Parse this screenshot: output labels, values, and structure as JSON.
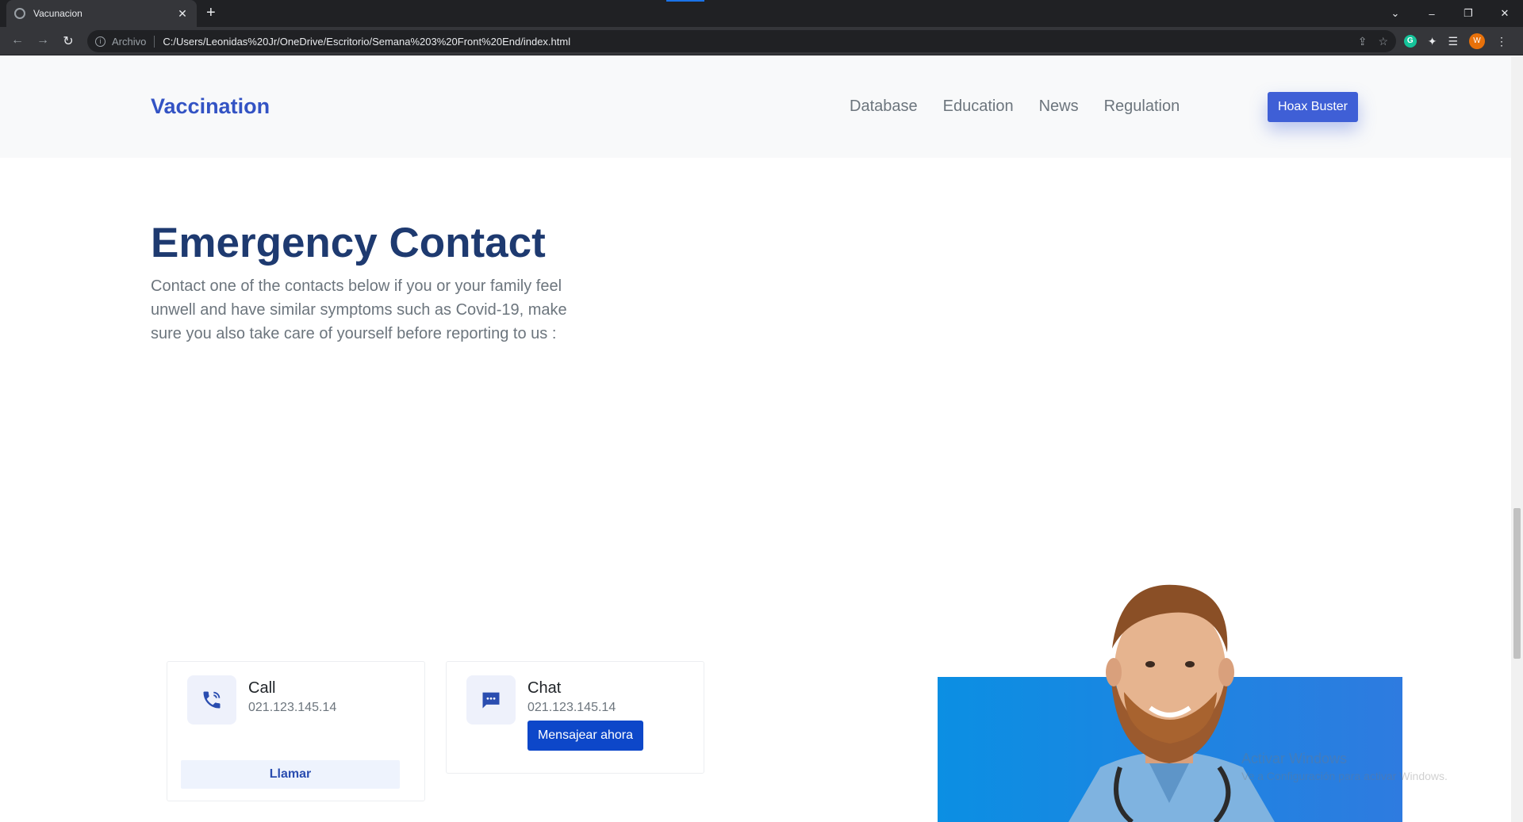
{
  "browser": {
    "tab_title": "Vacunacion",
    "new_tab": "+",
    "address_label": "Archivo",
    "url": "C:/Users/Leonidas%20Jr/OneDrive/Escritorio/Semana%203%20Front%20End/index.html",
    "profile_initial": "W",
    "window_controls": [
      "⌄",
      "–",
      "❐",
      "✕"
    ]
  },
  "header": {
    "brand": "Vaccination",
    "nav": [
      "Database",
      "Education",
      "News",
      "Regulation"
    ],
    "cta": "Hoax Buster"
  },
  "main": {
    "heading": "Emergency Contact",
    "intro": "Contact one of the contacts below if you or your family feel unwell and have similar symptoms such as Covid-19, make sure you also take care of yourself before reporting to us :"
  },
  "contacts": {
    "call": {
      "title": "Call",
      "number": "021.123.145.14",
      "button": "Llamar"
    },
    "chat": {
      "title": "Chat",
      "number": "021.123.145.14",
      "button": "Mensajear ahora"
    }
  },
  "watermark": {
    "line1": "Activar Windows",
    "line2": "Ve a Configuración para activar Windows."
  },
  "colors": {
    "brand": "#3353c4",
    "heading": "#1e3a70",
    "primary_button": "#3f5fd6",
    "chat_button": "#0d47c9"
  }
}
